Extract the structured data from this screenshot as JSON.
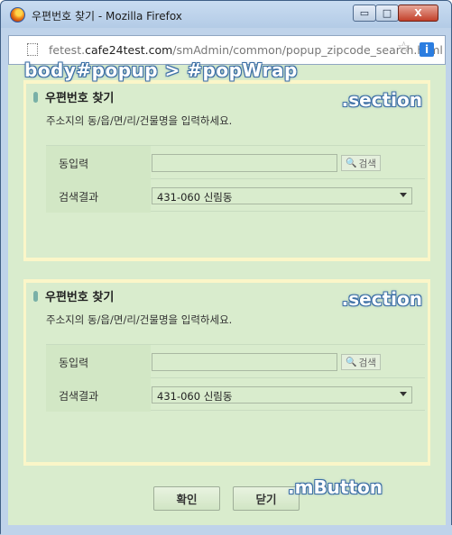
{
  "window": {
    "title": "우편번호 찾기 - Mozilla Firefox",
    "minimize": "▭",
    "maximize": "□",
    "close": "X"
  },
  "addressbar": {
    "url_prefix": "fetest.",
    "url_host": "cafe24test.com",
    "url_path": "/smAdmin/common/popup_zipcode_search.html",
    "star_icon": "star-icon",
    "info_icon_glyph": "i"
  },
  "debug_labels": {
    "wrap": "body#popup > #popWrap",
    "section": ".section",
    "mbutton": ".mButton"
  },
  "sections": [
    {
      "title": "우편번호 찾기",
      "description": "주소지의 동/읍/면/리/건물명을 입력하세요.",
      "input_label": "동입력",
      "input_value": "",
      "search_button": "검색",
      "result_label": "검색결과",
      "result_value": "431-060 신림동"
    },
    {
      "title": "우편번호 찾기",
      "description": "주소지의 동/읍/면/리/건물명을 입력하세요.",
      "input_label": "동입력",
      "input_value": "",
      "search_button": "검색",
      "result_label": "검색결과",
      "result_value": "431-060 신림동"
    }
  ],
  "buttons": {
    "confirm": "확인",
    "close": "닫기"
  },
  "colors": {
    "panel_bg": "#d9eccd",
    "section_border": "#fbf6c8",
    "window_frame": "#bfd3ea",
    "debug_text_outline": "#3b6ea5"
  }
}
